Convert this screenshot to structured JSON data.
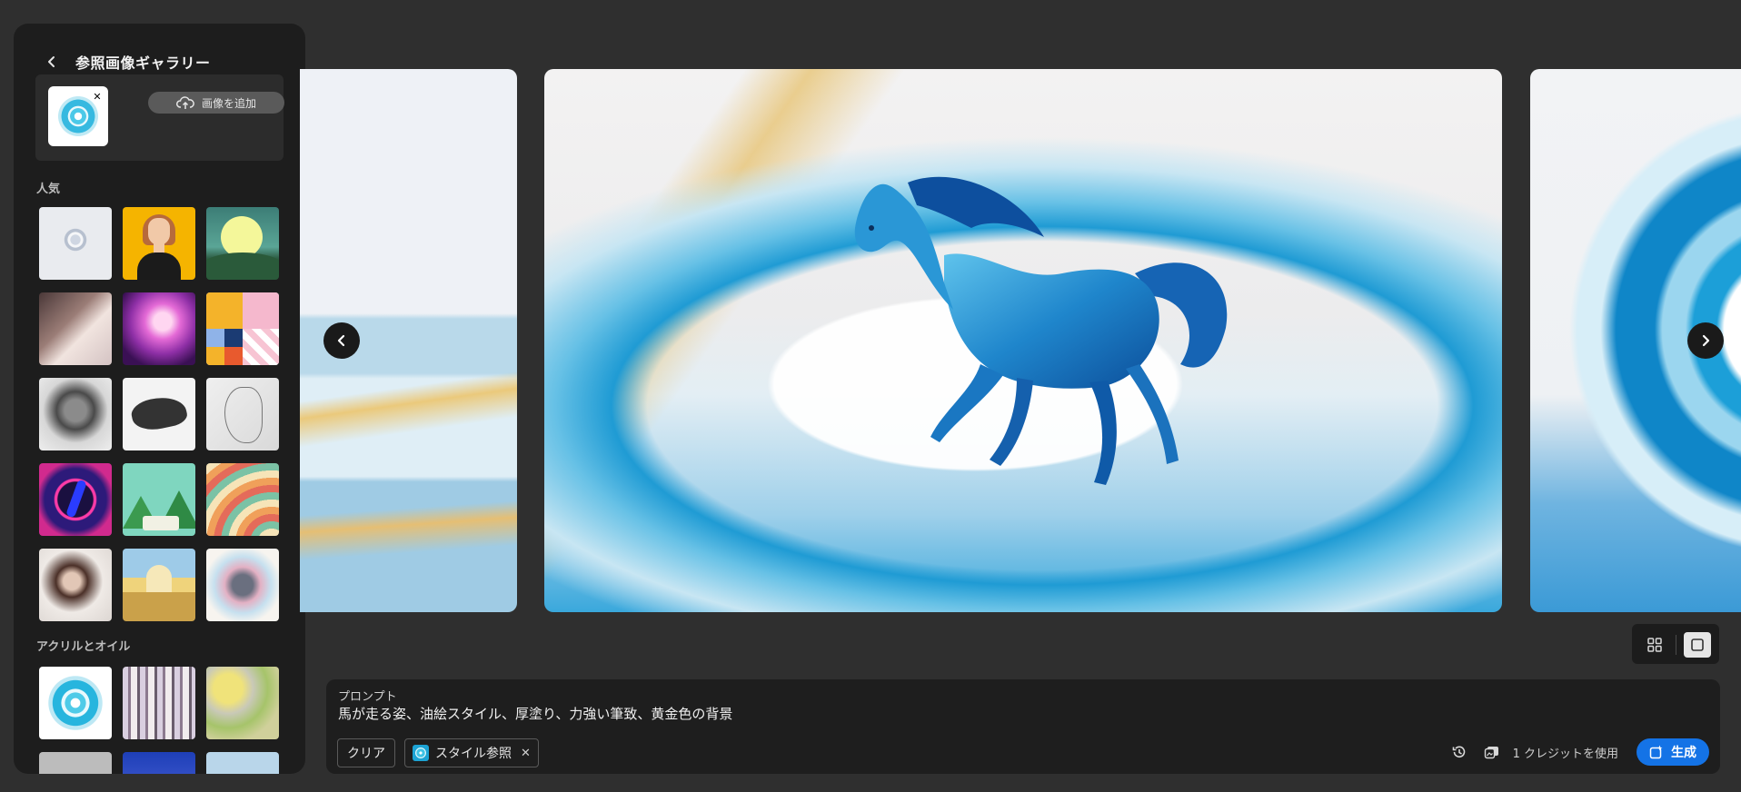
{
  "panel": {
    "title": "参照画像ギャラリー",
    "add_image_label": "画像を追加",
    "sections": [
      {
        "label": "人気"
      },
      {
        "label": "アクリルとオイル"
      }
    ]
  },
  "prompt": {
    "label": "プロンプト",
    "text": "馬が走る姿、油絵スタイル、厚塗り、力強い筆致、黄金色の背景",
    "clear_label": "クリア",
    "style_chip_label": "スタイル参照",
    "credit_text": "1 クレジットを使用",
    "generate_label": "生成"
  },
  "colors": {
    "accent": "#1473e6",
    "panel_bg": "#1d1d1d",
    "page_bg": "#2f2f2f"
  },
  "icons": {
    "back": "chevron-left-icon",
    "upload": "cloud-upload-icon",
    "remove": "close-icon",
    "prev": "chevron-left-icon",
    "next": "chevron-right-icon",
    "grid_view": "grid-icon",
    "single_view": "square-icon",
    "history": "history-icon",
    "settings": "image-settings-icon",
    "generate": "sparkle-generate-icon"
  }
}
